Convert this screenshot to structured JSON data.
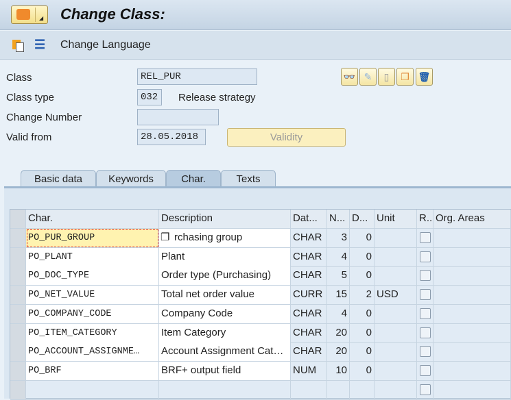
{
  "header": {
    "title": "Change Class:"
  },
  "toolbar": {
    "change_language": "Change Language"
  },
  "form": {
    "class_label": "Class",
    "class_value": "REL_PUR",
    "class_type_label": "Class type",
    "class_type_value": "032",
    "class_type_desc": "Release strategy",
    "change_number_label": "Change Number",
    "change_number_value": "",
    "valid_from_label": "Valid from",
    "valid_from_value": "28.05.2018",
    "validity_button": "Validity"
  },
  "tabs": [
    {
      "label": "Basic data"
    },
    {
      "label": "Keywords"
    },
    {
      "label": "Char.",
      "active": true
    },
    {
      "label": "Texts"
    }
  ],
  "grid": {
    "columns": [
      "Char.",
      "Description",
      "Dat...",
      "N...",
      "D...",
      "Unit",
      "R..",
      "Org. Areas"
    ],
    "rows": [
      {
        "char": "PO_PUR_GROUP",
        "desc": "rchasing group",
        "type": "CHAR",
        "n": "3",
        "d": "0",
        "unit": ""
      },
      {
        "char": "PO_PLANT",
        "desc": "Plant",
        "type": "CHAR",
        "n": "4",
        "d": "0",
        "unit": ""
      },
      {
        "char": "PO_DOC_TYPE",
        "desc": "Order type (Purchasing)",
        "type": "CHAR",
        "n": "5",
        "d": "0",
        "unit": ""
      },
      {
        "char": "PO_NET_VALUE",
        "desc": "Total net order value",
        "type": "CURR",
        "n": "15",
        "d": "2",
        "unit": "USD"
      },
      {
        "char": "PO_COMPANY_CODE",
        "desc": "Company Code",
        "type": "CHAR",
        "n": "4",
        "d": "0",
        "unit": ""
      },
      {
        "char": "PO_ITEM_CATEGORY",
        "desc": "Item Category",
        "type": "CHAR",
        "n": "20",
        "d": "0",
        "unit": ""
      },
      {
        "char": "PO_ACCOUNT_ASSIGNME…",
        "desc": "Account Assignment Cat…",
        "type": "CHAR",
        "n": "20",
        "d": "0",
        "unit": ""
      },
      {
        "char": "PO_BRF",
        "desc": "BRF+ output field",
        "type": "NUM",
        "n": "10",
        "d": "0",
        "unit": ""
      },
      {
        "char": "",
        "desc": "",
        "type": "",
        "n": "",
        "d": "",
        "unit": ""
      }
    ]
  }
}
